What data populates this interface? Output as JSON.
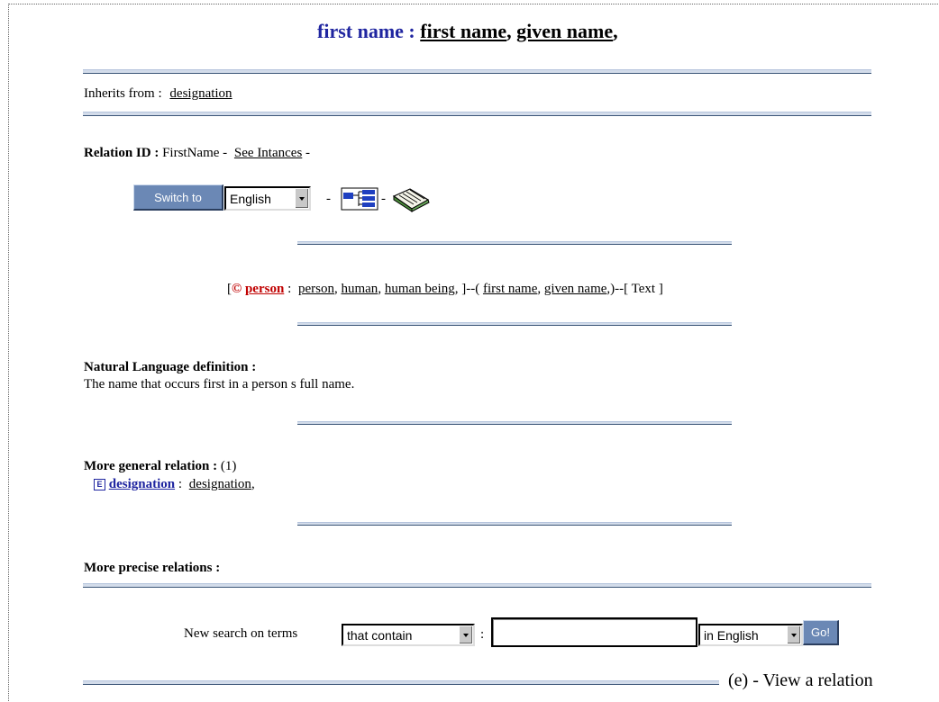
{
  "header": {
    "label": "first name :",
    "term1": "first name",
    "sep": ",",
    "term2": "given name",
    "trail": ","
  },
  "inherits": {
    "label": "Inherits from :",
    "link": "designation"
  },
  "relation_id": {
    "label": "Relation ID :",
    "value": "FirstName -",
    "instances_link": "See Intances",
    "trail": "-"
  },
  "controls": {
    "switch_label": "Switch to",
    "language_selected": "English",
    "dash1": "-",
    "dash2": "-",
    "tree_icon": "hierarchy-icon",
    "book_icon": "book-icon"
  },
  "signature": {
    "open_bracket": "[",
    "concept_symbol": "©",
    "concept": "person",
    "colon": ":",
    "syn1": "person",
    "syn2": "human",
    "syn3": "human being",
    "mid": ", ]--(",
    "rel1": "first name",
    "rel2": "given name",
    "close": ",)--[ Text ]"
  },
  "definition": {
    "title": "Natural Language definition :",
    "text": "The name that occurs first in a person s full name."
  },
  "general": {
    "title": "More general relation :",
    "count": "(1)",
    "symbol": "E",
    "link": "designation",
    "colon": ":",
    "synonym": "designation",
    "trail": ","
  },
  "precise": {
    "title": "More precise relations :"
  },
  "search": {
    "label": "New search on terms",
    "mode_selected": "that contain",
    "colon": ":",
    "query_value": "",
    "language_selected": "in English",
    "go_label": "Go!"
  },
  "caption": "(e) - View a relation"
}
